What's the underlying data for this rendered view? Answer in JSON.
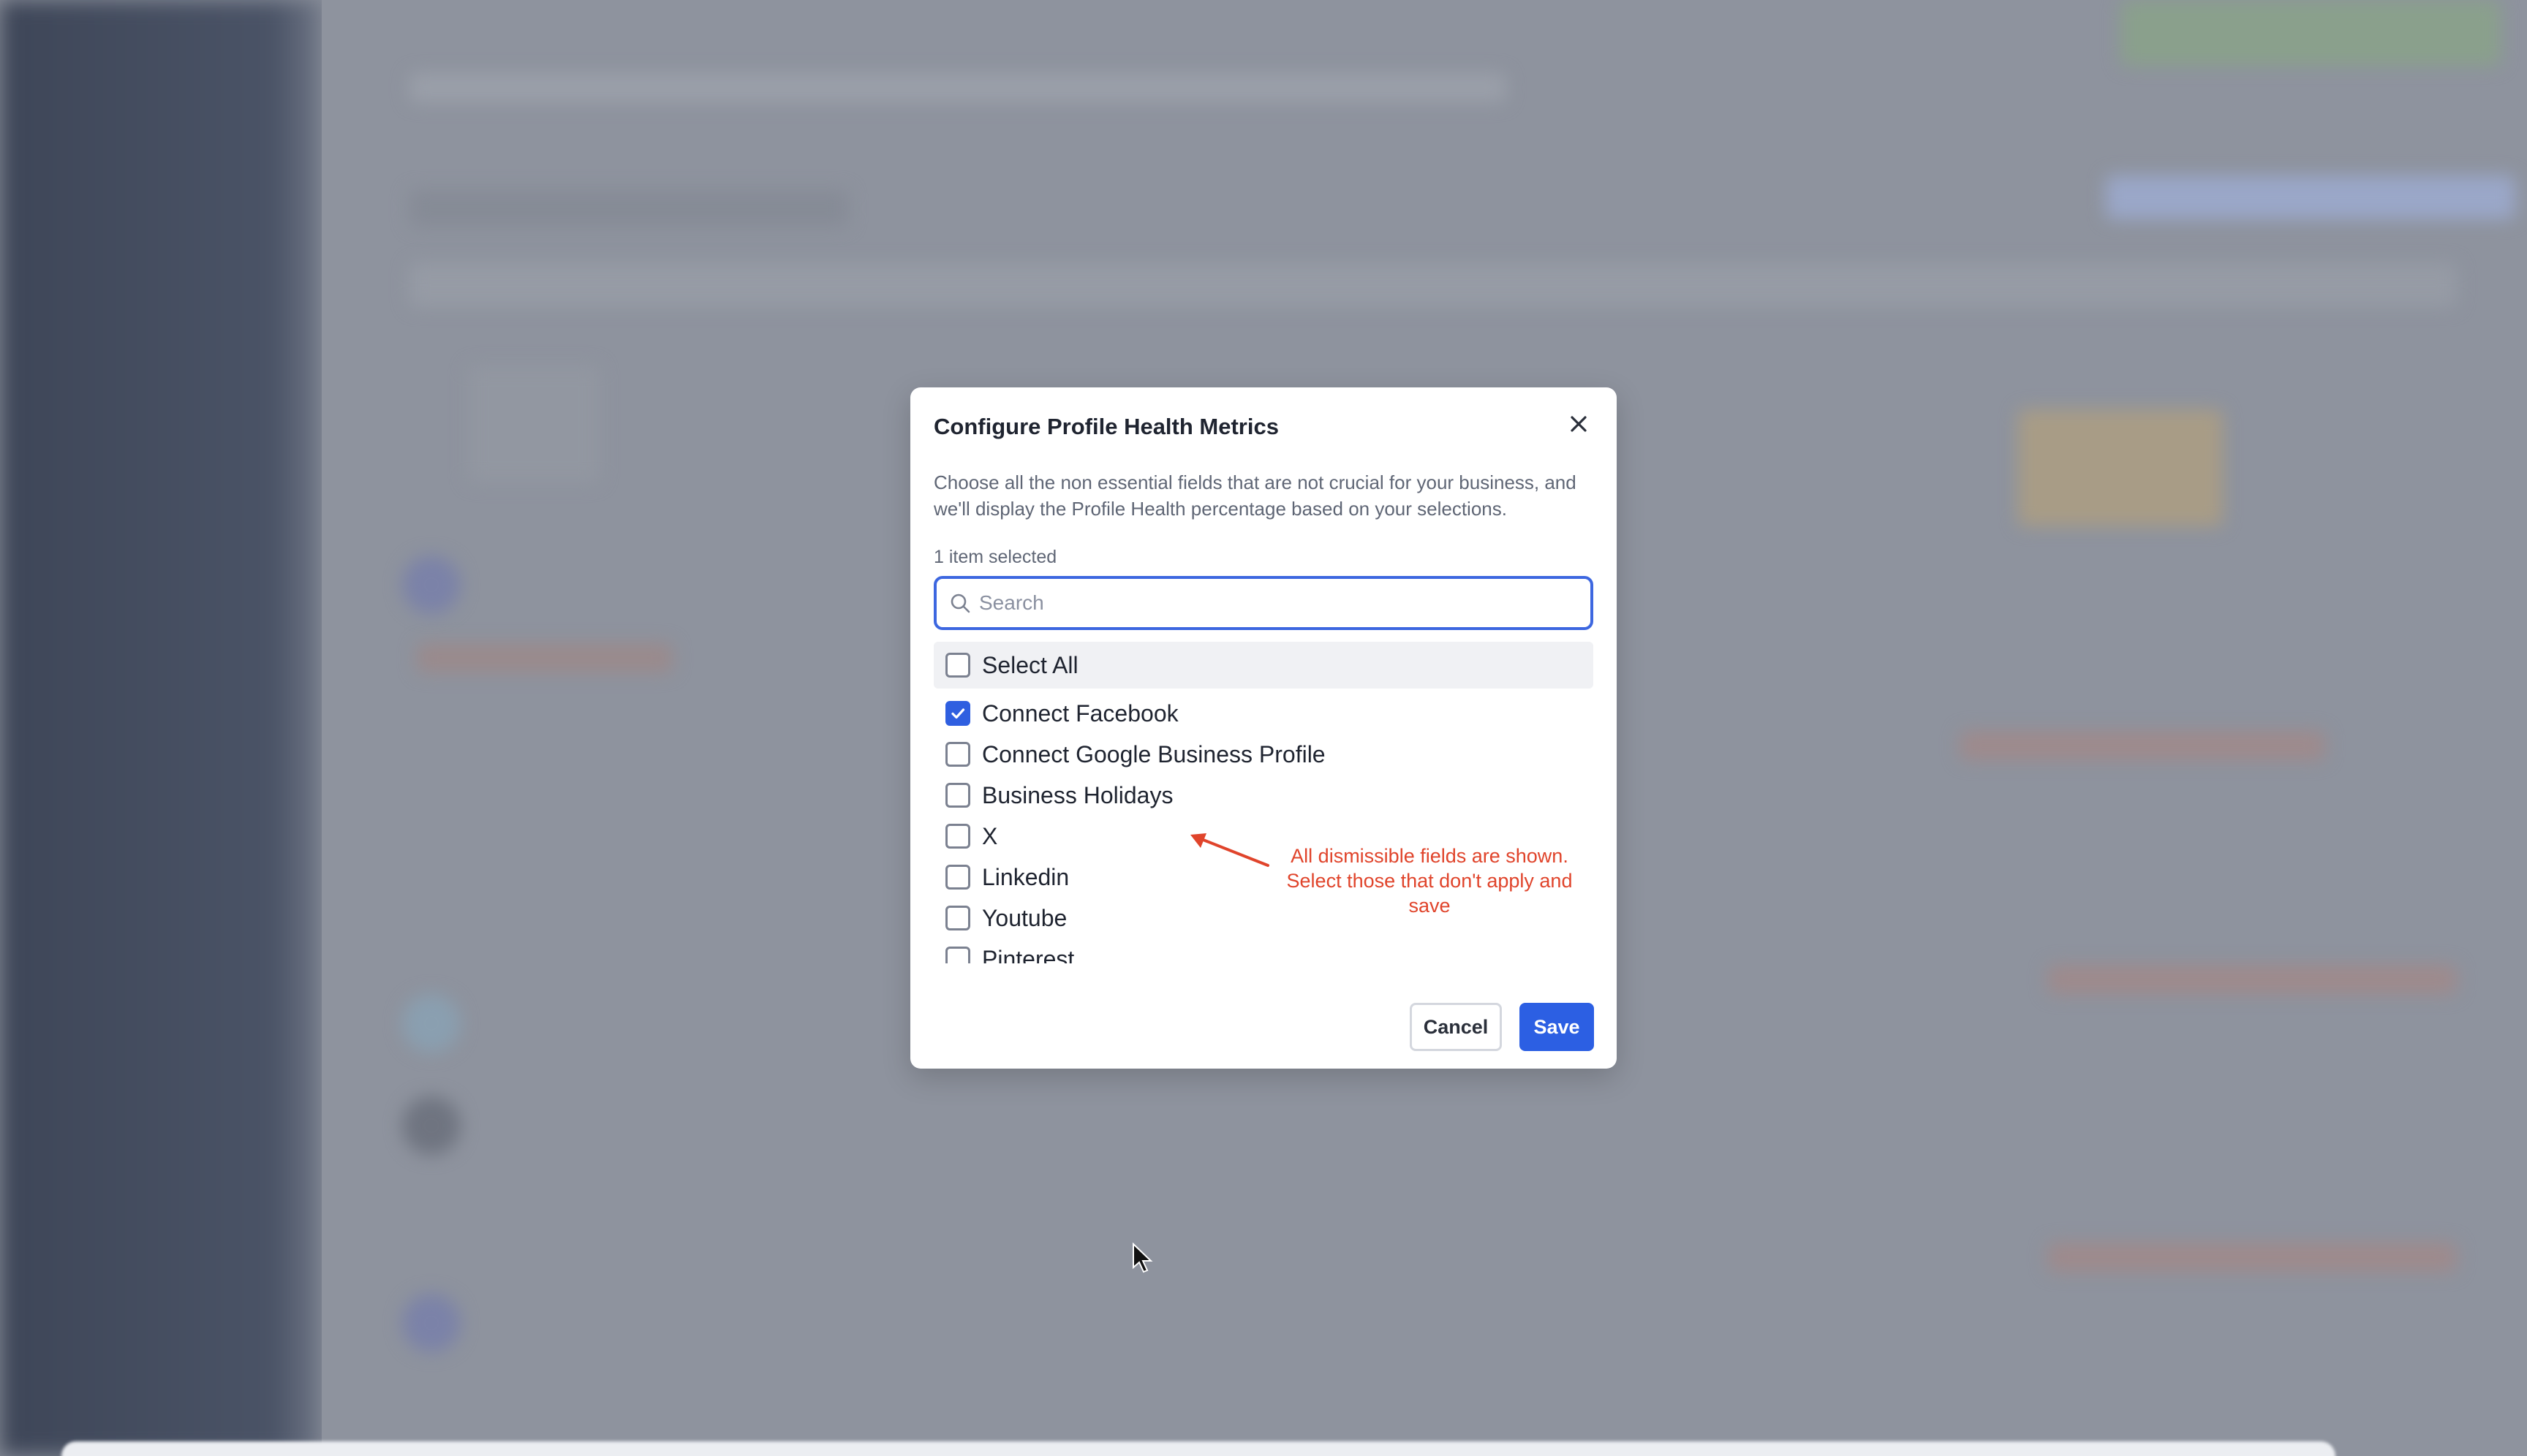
{
  "modal": {
    "title": "Configure Profile Health Metrics",
    "description": "Choose all the non essential fields that are not crucial for your business, and we'll display the Profile Health percentage based on your selections.",
    "selected_count": "1 item selected",
    "search": {
      "placeholder": "Search",
      "value": ""
    },
    "select_all_label": "Select All",
    "options": [
      {
        "label": "Connect Facebook",
        "checked": true
      },
      {
        "label": "Connect Google Business Profile",
        "checked": false
      },
      {
        "label": "Business Holidays",
        "checked": false
      },
      {
        "label": "X",
        "checked": false
      },
      {
        "label": "Linkedin",
        "checked": false
      },
      {
        "label": "Youtube",
        "checked": false
      },
      {
        "label": "Pinterest",
        "checked": false
      }
    ],
    "cancel_label": "Cancel",
    "save_label": "Save"
  },
  "annotation": {
    "text": "All dismissible fields are shown. Select those that don't apply and save",
    "color": "#e0442b"
  },
  "colors": {
    "accent": "#2c5fe3",
    "overlay": "#8b909b"
  },
  "icons": {
    "close": "close-icon",
    "search": "search-icon",
    "check": "check-icon"
  }
}
